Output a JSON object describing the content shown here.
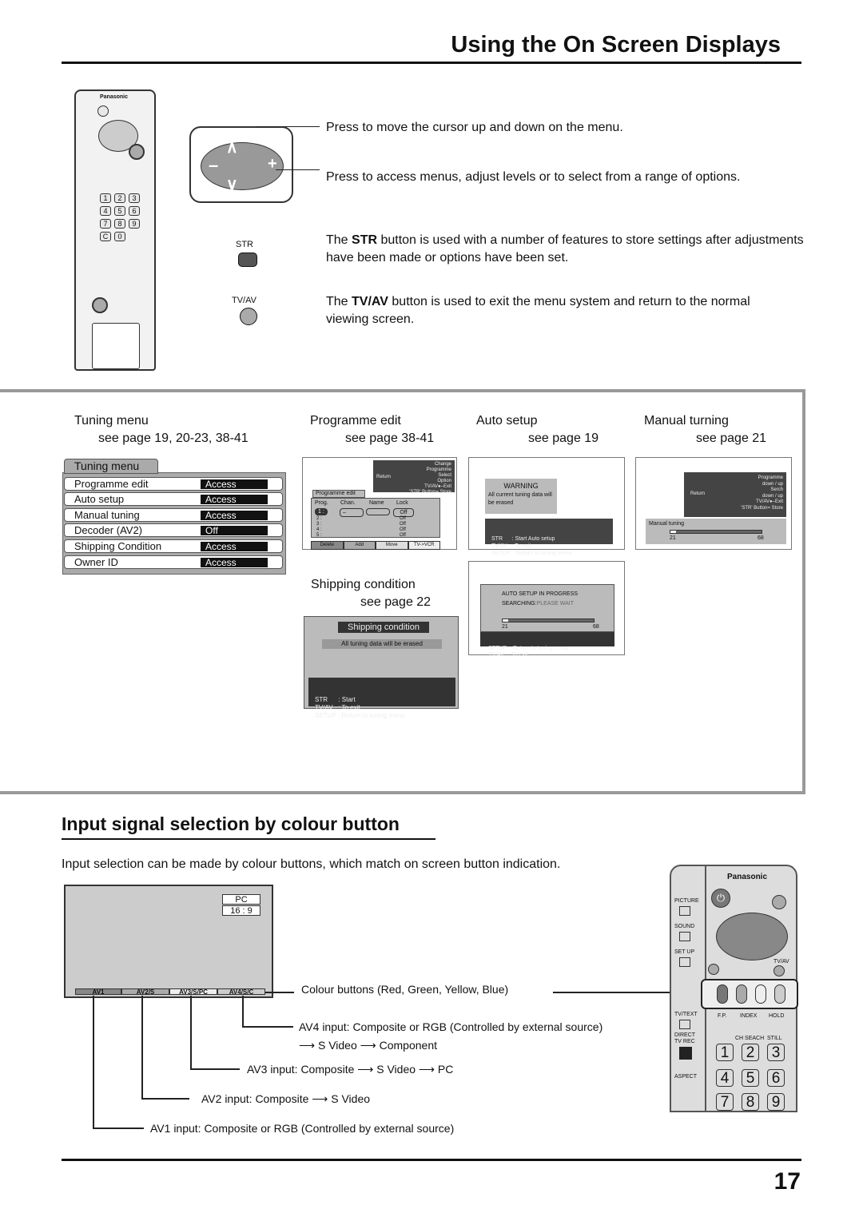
{
  "header": {
    "title": "Using the On Screen Displays"
  },
  "remote_small": {
    "brand": "Panasonic",
    "keys": [
      "1",
      "2",
      "3",
      "4",
      "5",
      "6",
      "7",
      "8",
      "9",
      "C",
      "0"
    ]
  },
  "callouts": {
    "cursor": "Press to move the cursor up and down on the menu.",
    "access": "Press to access menus, adjust levels or to select from a range of options.",
    "str_label": "STR",
    "str_pre": "The ",
    "str_bold": "STR",
    "str_post": " button is used with a number of features to store settings after adjustments have been made or options have been set.",
    "tvav_label": "TV/AV",
    "tvav_pre": "The ",
    "tvav_bold": "TV/AV",
    "tvav_post": " button is used to exit the menu system and return to the normal viewing screen."
  },
  "menus": {
    "tuning": {
      "title": "Tuning menu",
      "page": "see page 19, 20-23, 38-41",
      "tab": "Tuning menu",
      "rows": [
        {
          "label": "Programme edit",
          "value": "Access"
        },
        {
          "label": "Auto setup",
          "value": "Access"
        },
        {
          "label": "Manual tuning",
          "value": "Access"
        },
        {
          "label": "Decoder (AV2)",
          "value": "Off"
        },
        {
          "label": "Shipping Condition",
          "value": "Access"
        },
        {
          "label": "Owner ID",
          "value": "Access"
        }
      ]
    },
    "programme_edit": {
      "title": "Programme edit",
      "page": "see page 38-41",
      "tab": "Programme edit",
      "help": [
        "Change",
        "Programme",
        "Return",
        "Select",
        "Option",
        "TV/AV●–Exit",
        "'STR' Button= Store"
      ],
      "columns": [
        "Prog.",
        "Chan.",
        "Name",
        "Lock"
      ],
      "rows": [
        {
          "prog": "1 :",
          "chan": "–",
          "lock": "Off"
        },
        {
          "prog": "2 :",
          "lock": "Off"
        },
        {
          "prog": "3 :",
          "lock": "Off"
        },
        {
          "prog": "4 :",
          "lock": "Off"
        },
        {
          "prog": "5 :",
          "lock": "Off"
        }
      ],
      "buttons": [
        "Delete",
        "Add",
        "Move",
        "TV->VCR"
      ]
    },
    "auto_setup": {
      "title": "Auto setup",
      "page": "see page 19",
      "warning": "WARNING",
      "warning_text": "All current tuning data will be erased",
      "help": [
        "STR      : Start Auto setup",
        "TV/AV   : To exit",
        "SETUP  : Return to tuning menu"
      ]
    },
    "manual": {
      "title": "Manual turning",
      "page": "see page 21",
      "help": [
        "Programme",
        "down / up",
        "Return",
        "Serch",
        "down / up",
        "TV/AV●–Exit",
        "'STR'  Button= Store"
      ],
      "label": "Manual tuning",
      "min": "21",
      "max": "68"
    },
    "shipping": {
      "title": "Shipping condition",
      "page": "see page 22",
      "heading": "Shipping condition",
      "notice": "All tuning data will be erased",
      "help": [
        "STR      : Start",
        "TV/AV   : To exit",
        "SETUP : Return to tuning menu"
      ]
    },
    "progress": {
      "line1": "AUTO SETUP IN PROGRESS",
      "line2a": "SEARCHING:",
      "line2b": "PLEASE WAIT",
      "min": "21",
      "max": "68",
      "help": [
        "SETUP  : Return to tuning menu",
        "TV/AV   : To exit"
      ]
    }
  },
  "section2": {
    "title": "Input signal selection by colour button",
    "intro": "Input selection can be made by colour buttons, which match on screen button indication.",
    "screen": {
      "badge1": "PC",
      "badge2": "16 : 9",
      "buttons": [
        "AV1",
        "AV2/S",
        "AV3/S/PC",
        "AV4/S/C"
      ]
    },
    "labels": {
      "colour": "Colour buttons (Red, Green, Yellow, Blue)",
      "av4a": "AV4 input: Composite or RGB (Controlled by external source)",
      "av4b": "S Video",
      "av4c": "Component",
      "av3a": "AV3 input: Composite",
      "av3b": "S Video",
      "av3c": "PC",
      "av2a": "AV2 input: Composite",
      "av2b": "S Video",
      "av1": "AV1 input: Composite or RGB (Controlled by external source)"
    },
    "remote": {
      "brand": "Panasonic",
      "left": [
        "PICTURE",
        "SOUND",
        "SET UP",
        "TV/TEXT",
        "DIRECT TV REC",
        "ASPECT"
      ],
      "top": [
        "F.P.",
        "INDEX",
        "HOLD"
      ],
      "mid": [
        "CH SEACH",
        "STILL"
      ],
      "tvav": "TV/AV",
      "keys": [
        "1",
        "2",
        "3",
        "4",
        "5",
        "6",
        "7",
        "8",
        "9"
      ]
    }
  },
  "footer": {
    "page_number": "17"
  }
}
